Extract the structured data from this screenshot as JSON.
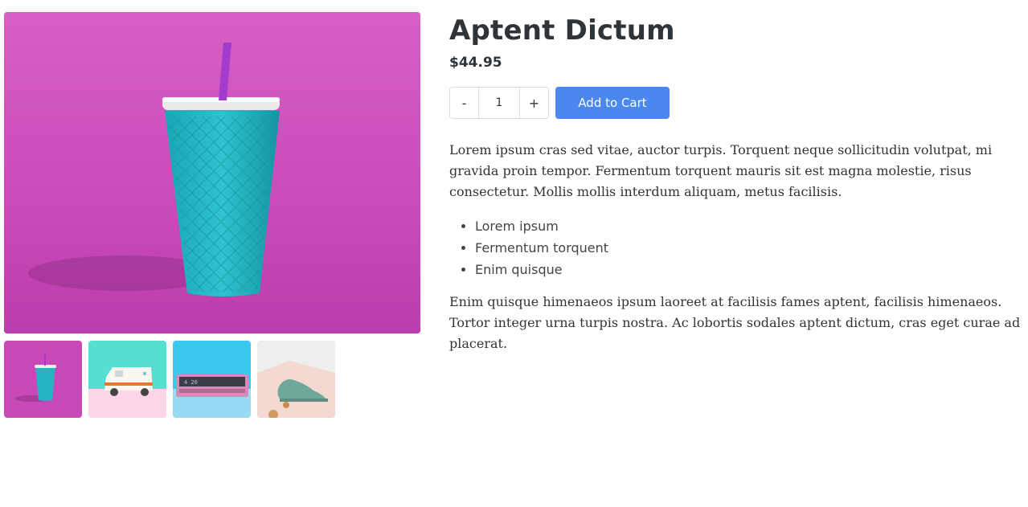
{
  "product": {
    "title": "Aptent Dictum",
    "price": "$44.95",
    "quantity": "1",
    "decrement_label": "-",
    "increment_label": "+",
    "add_to_cart_label": "Add to Cart",
    "description": "Lorem ipsum cras sed vitae, auctor turpis. Torquent neque sollicitudin volutpat, mi gravida proin tempor. Fermentum torquent mauris sit est magna molestie, risus consectetur. Mollis mollis interdum aliquam, metus facilisis.",
    "features": [
      "Lorem ipsum",
      "Fermentum torquent",
      "Enim quisque"
    ],
    "description_2": "Enim quisque himenaeos ipsum laoreet at facilisis fames aptent, facilisis himenaeos. Tortor integer urna turpis nostra. Ac lobortis sodales aptent dictum, cras eget curae ad placerat."
  },
  "gallery": {
    "thumbnails": [
      "cup-icon",
      "ambulance-icon",
      "alarm-clock-icon",
      "shoe-icon"
    ]
  },
  "colors": {
    "accent": "#4a88ef",
    "title": "#2f3438"
  }
}
